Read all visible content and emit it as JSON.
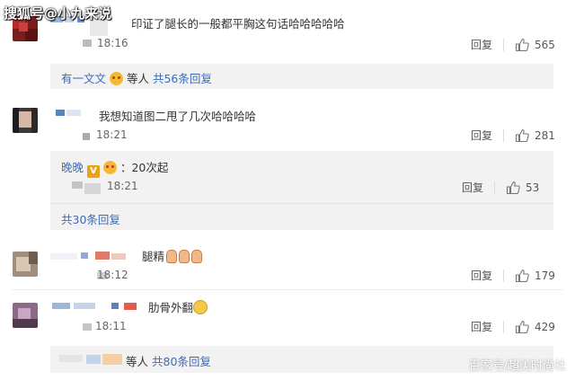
{
  "watermarks": {
    "top": "搜狐号@小九来说",
    "bottom": "百家号/超美时尚社"
  },
  "comments": [
    {
      "text": "印证了腿长的一般都平胸这句话哈哈哈哈哈",
      "time": "18:16",
      "reply_label": "回复",
      "likes": "565"
    },
    {
      "text": "我想知道图二甩了几次哈哈哈哈",
      "time": "18:21",
      "reply_label": "回复",
      "likes": "281"
    },
    {
      "text": "腿精",
      "time": "18:12",
      "reply_label": "回复",
      "likes": "179"
    },
    {
      "text": "肋骨外翻",
      "time": "18:11",
      "reply_label": "回复",
      "likes": "429"
    }
  ],
  "thread1": {
    "summary_name": "有一文文",
    "summary_suffix": "等人",
    "summary_link": "共56条回复"
  },
  "thread2": {
    "reply_name": "晚晚",
    "reply_text": "：20次起",
    "reply_time": "18:21",
    "reply_label": "回复",
    "reply_likes": "53",
    "more_link": "共30条回复"
  },
  "thread4": {
    "summary_suffix": "等人",
    "summary_link": "共80条回复"
  },
  "colors": {
    "link": "#3d6ab7",
    "reply_bg": "#f2f2f2"
  },
  "icons": {
    "like": "thumbs-up-icon",
    "emoji": "emoji-icon",
    "vip": "vip-badge-icon"
  }
}
